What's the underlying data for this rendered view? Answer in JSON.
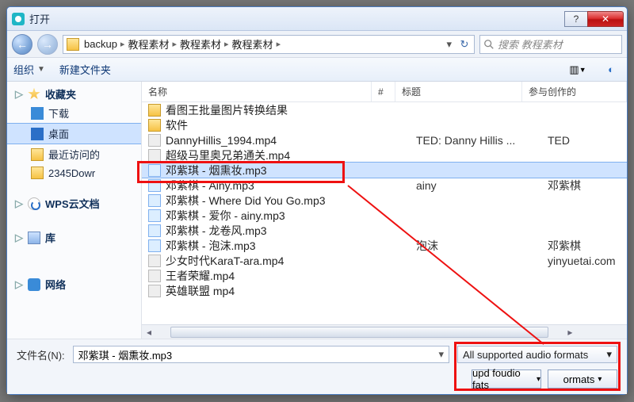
{
  "window": {
    "title": "打开"
  },
  "nav": {
    "back_icon": "←",
    "fwd_icon": "→",
    "crumbs": [
      "backup",
      "教程素材",
      "教程素材",
      "教程素材"
    ],
    "refresh_icon": "↻"
  },
  "search": {
    "placeholder": "搜索 教程素材"
  },
  "toolbar": {
    "organize": "组织",
    "newfolder": "新建文件夹"
  },
  "sidebar": {
    "favorites": "收藏夹",
    "downloads": "下载",
    "desktop": "桌面",
    "recent": "最近访问的",
    "folder2345": "2345Dowr",
    "wps": "WPS云文档",
    "library": "库",
    "network": "网络"
  },
  "columns": {
    "name": "名称",
    "num": "#",
    "title": "标题",
    "artist": "参与创作的"
  },
  "files": [
    {
      "type": "folder",
      "name": "看图王批量图片转换结果",
      "title": "",
      "artist": ""
    },
    {
      "type": "folder",
      "name": "软件",
      "title": "",
      "artist": ""
    },
    {
      "type": "vid",
      "name": "DannyHillis_1994.mp4",
      "title": "TED: Danny Hillis ...",
      "artist": "TED"
    },
    {
      "type": "vid",
      "name": "超级马里奥兄弟通关.mp4",
      "title": "",
      "artist": ""
    },
    {
      "type": "aud",
      "name": "邓紫琪 - 烟熏妆.mp3",
      "title": "",
      "artist": "",
      "selected": true
    },
    {
      "type": "aud",
      "name": "邓紫棋 - Ainy.mp3",
      "title": "ainy",
      "artist": "邓紫棋"
    },
    {
      "type": "aud",
      "name": "邓紫棋 - Where Did You Go.mp3",
      "title": "",
      "artist": ""
    },
    {
      "type": "aud",
      "name": "邓紫棋 - 爱你 - ainy.mp3",
      "title": "",
      "artist": ""
    },
    {
      "type": "aud",
      "name": "邓紫棋 - 龙卷风.mp3",
      "title": "",
      "artist": ""
    },
    {
      "type": "aud",
      "name": "邓紫棋 - 泡沫.mp3",
      "title": "泡沫",
      "artist": "邓紫棋"
    },
    {
      "type": "vid",
      "name": "少女时代KaraT-ara.mp4",
      "title": "",
      "artist": "yinyuetai.com"
    },
    {
      "type": "vid",
      "name": "王者荣耀.mp4",
      "title": "",
      "artist": ""
    },
    {
      "type": "vid",
      "name": "英雄联盟 mp4",
      "title": "",
      "artist": ""
    }
  ],
  "footer": {
    "filename_label": "文件名(N):",
    "filename_value": "邓紫琪 - 烟熏妆.mp3",
    "filter": "All supported audio formats",
    "open_btn": "upd foudio fats",
    "cancel_btn": "ormats"
  }
}
